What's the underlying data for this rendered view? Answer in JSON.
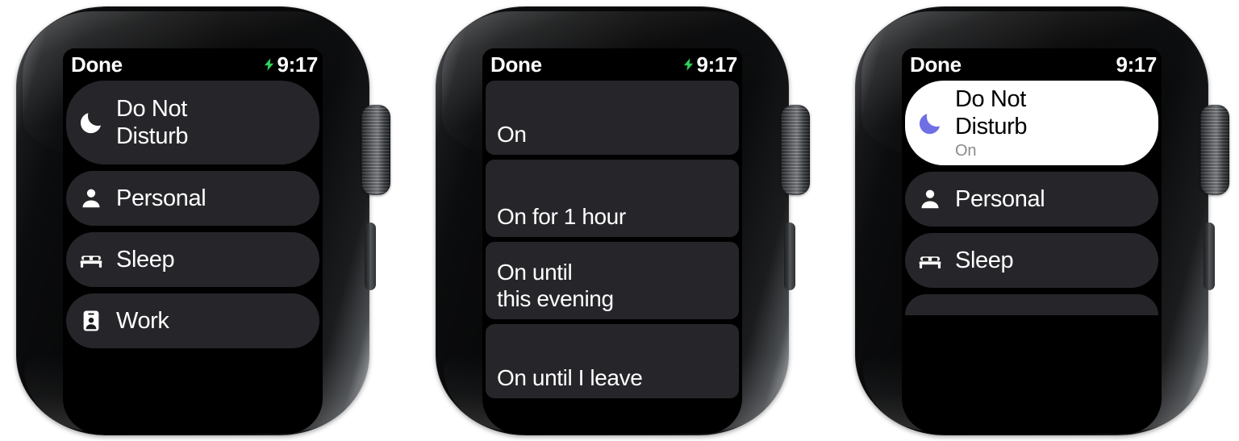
{
  "meta": {
    "title": "Apple Watch Do Not Disturb / Focus settings — three states",
    "accent_green": "#30D158",
    "accent_purple": "#6E6FE3",
    "row_bg": "#26262A",
    "active_row_bg": "#FFFFFF",
    "subtitle_gray": "#8A8A8E"
  },
  "watches": [
    {
      "id": "watch-1",
      "status": {
        "back_label": "Done",
        "charging_icon": "lightning-bolt-icon",
        "charging_visible": true,
        "time": "9:17"
      },
      "rows": [
        {
          "icon": "moon-icon",
          "icon_color": "#FFFFFF",
          "title": "Do Not\nDisturb",
          "subtitle": "",
          "style": "pill tall",
          "active": false
        },
        {
          "icon": "person-icon",
          "icon_color": "#FFFFFF",
          "title": "Personal",
          "subtitle": "",
          "style": "pill",
          "active": false
        },
        {
          "icon": "bed-icon",
          "icon_color": "#FFFFFF",
          "title": "Sleep",
          "subtitle": "",
          "style": "pill",
          "active": false
        },
        {
          "icon": "id-badge-icon",
          "icon_color": "#FFFFFF",
          "title": "Work",
          "subtitle": "",
          "style": "pill",
          "active": false
        }
      ]
    },
    {
      "id": "watch-2",
      "status": {
        "back_label": "Done",
        "charging_icon": "lightning-bolt-icon",
        "charging_visible": true,
        "time": "9:17"
      },
      "rows": [
        {
          "icon": "",
          "icon_color": "",
          "title": "On",
          "subtitle": "",
          "style": "card h1",
          "active": false
        },
        {
          "icon": "",
          "icon_color": "",
          "title": "On for 1 hour",
          "subtitle": "",
          "style": "card h2",
          "active": false
        },
        {
          "icon": "",
          "icon_color": "",
          "title": "On until\nthis evening",
          "subtitle": "",
          "style": "card h3",
          "active": false
        },
        {
          "icon": "",
          "icon_color": "",
          "title": "On until I leave",
          "subtitle": "",
          "style": "card h4",
          "active": false
        }
      ]
    },
    {
      "id": "watch-3",
      "status": {
        "back_label": "Done",
        "charging_icon": "lightning-bolt-icon",
        "charging_visible": false,
        "time": "9:17"
      },
      "rows": [
        {
          "icon": "moon-icon",
          "icon_color": "#6E6FE3",
          "title": "Do Not\nDisturb",
          "subtitle": "On",
          "style": "pill tall",
          "active": true
        },
        {
          "icon": "person-icon",
          "icon_color": "#FFFFFF",
          "title": "Personal",
          "subtitle": "",
          "style": "pill",
          "active": false
        },
        {
          "icon": "bed-icon",
          "icon_color": "#FFFFFF",
          "title": "Sleep",
          "subtitle": "",
          "style": "pill",
          "active": false
        },
        {
          "icon": "",
          "icon_color": "",
          "title": "",
          "subtitle": "",
          "style": "partial",
          "active": false
        }
      ]
    }
  ]
}
